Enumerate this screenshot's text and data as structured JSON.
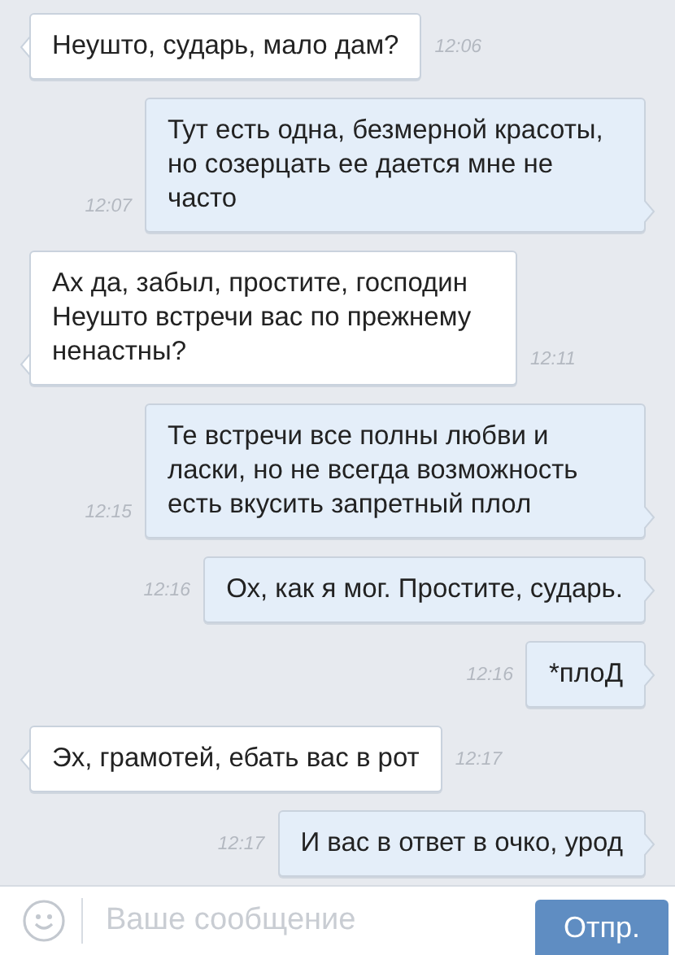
{
  "messages": [
    {
      "kind": "in",
      "text": "Неушто, сударь, мало дам?",
      "time": "12:06"
    },
    {
      "kind": "out",
      "text": "Тут есть одна, безмерной красоты, но созерцать ее дается мне не часто",
      "time": "12:07"
    },
    {
      "kind": "in",
      "text": "Ах да, забыл, простите, господин Неушто встречи вас по прежнему ненастны?",
      "time": "12:11"
    },
    {
      "kind": "out",
      "text": "Те встречи все полны любви и ласки, но не всегда возможность есть вкусить запретный плол",
      "time": "12:15"
    },
    {
      "kind": "out",
      "text": "Ох, как я мог. Простите, сударь.",
      "time": "12:16"
    },
    {
      "kind": "out",
      "text": "*плоД",
      "time": "12:16"
    },
    {
      "kind": "in",
      "text": "Эх, грамотей, ебать вас в рот",
      "time": "12:17"
    },
    {
      "kind": "out",
      "text": "И вас в ответ в очко, урод",
      "time": "12:17"
    }
  ],
  "composer": {
    "placeholder": "Ваше сообщение",
    "send": "Отпр."
  }
}
